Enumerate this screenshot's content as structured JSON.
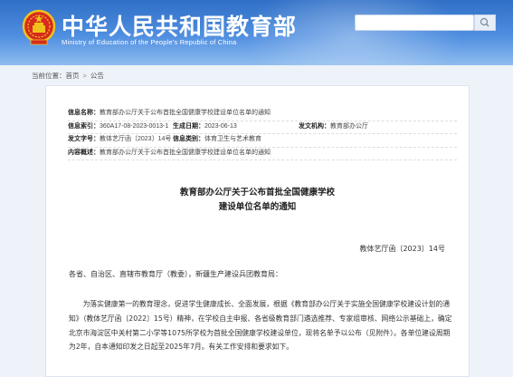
{
  "site": {
    "title": "中华人民共和国教育部",
    "subtitle": "Ministry of Education of the People's Republic of China"
  },
  "search": {
    "placeholder": ""
  },
  "breadcrumb": {
    "prefix": "当前位置：",
    "home": "首页",
    "separator": ">",
    "current": "公告"
  },
  "meta": {
    "info_name_label": "信息名称：",
    "info_name_value": "教育部办公厅关于公布首批全国健康学校建设单位名单的通知",
    "info_index_label": "信息索引：",
    "info_index_value": "360A17-08-2023-0013-1",
    "effective_date_label": "生成日期：",
    "effective_date_value": "2023-06-13",
    "issuer_label": "发文机构：",
    "issuer_value": "教育部办公厅",
    "doc_number_label": "发文字号：",
    "doc_number_value": "教体艺厅函〔2023〕14号",
    "category_label": "信息类别：",
    "category_value": "体育卫生与艺术教育",
    "content_label": "内容概述：",
    "content_value": "教育部办公厅关于公布首批全国健康学校建设单位名单的通知"
  },
  "doc": {
    "title_line1": "教育部办公厅关于公布首批全国健康学校",
    "title_line2": "建设单位名单的通知",
    "number": "教体艺厅函〔2023〕14号",
    "salutation": "各省、自治区、直辖市教育厅（教委），新疆生产建设兵团教育局：",
    "paragraph": "为落实健康第一的教育理念，促进学生健康成长、全面发展，根据《教育部办公厅关于实施全国健康学校建设计划的通知》（教体艺厅函〔2022〕15号）精神，在学校自主申报、各省级教育部门遴选推荐、专家组审核、网络公示基础上，确定北京市海淀区中关村第二小学等1075所学校为首批全国健康学校建设单位，现将名单予以公布（见附件）。各单位建设周期为2年，自本通知印发之日起至2025年7月。有关工作安排和要求如下。"
  },
  "colors": {
    "header": "#2f6fc6",
    "emblem_red": "#d62b1e",
    "emblem_gold": "#f1c21b"
  }
}
